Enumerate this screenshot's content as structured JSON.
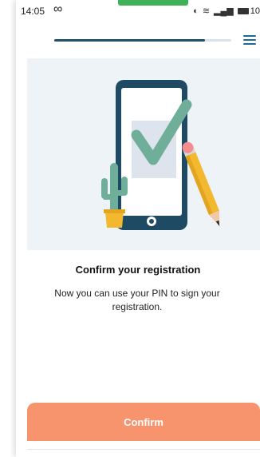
{
  "status_bar": {
    "time": "14:05",
    "loop_icon": "infinity-icon",
    "icons": [
      "alarm-icon",
      "wifi-icon",
      "signal-icon"
    ],
    "battery": "10"
  },
  "progress": {
    "fraction": 0.85
  },
  "menu": {
    "icon": "hamburger-menu-icon"
  },
  "illustration": {
    "description_icons": [
      "phone-icon",
      "checkmark-icon",
      "cactus-icon",
      "pencil-icon"
    ]
  },
  "content": {
    "title": "Confirm your registration",
    "description": "Now you can use your PIN to sign your registration."
  },
  "actions": {
    "confirm_label": "Confirm"
  },
  "colors": {
    "accent": "#f7946d",
    "progress": "#1f4f6a",
    "menu": "#1c6b96",
    "check": "#6fae98"
  }
}
